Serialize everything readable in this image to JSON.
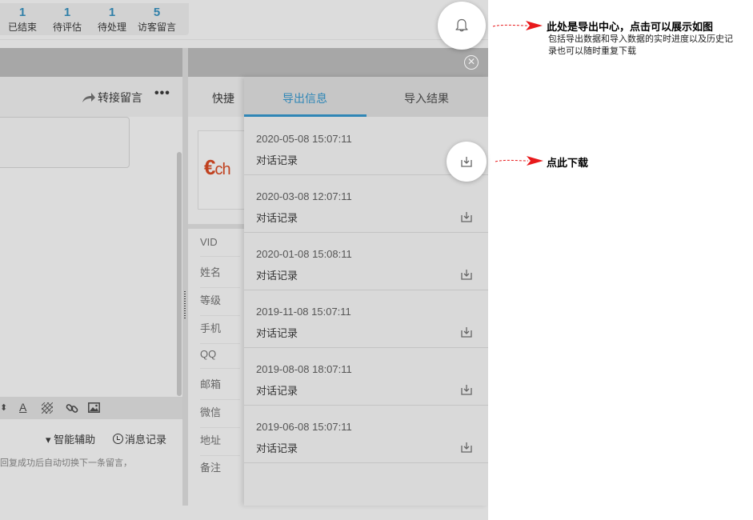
{
  "stats": [
    {
      "count": "1",
      "label": "已结束"
    },
    {
      "count": "1",
      "label": "待评估"
    },
    {
      "count": "1",
      "label": "待处理"
    },
    {
      "count": "5",
      "label": "访客留言"
    }
  ],
  "left_pane": {
    "transfer_label": "转接留言",
    "more_label": "•••",
    "assist_label": "▾ 智能辅助",
    "history_label": "消息记录",
    "hint_text": "回复成功后自动切换下一条留言，"
  },
  "middle_pane": {
    "tab_label": "快捷",
    "logo_text": "ch",
    "fields": [
      "VID",
      "姓名",
      "等级",
      "手机",
      "QQ",
      "邮箱",
      "微信",
      "地址",
      "备注"
    ]
  },
  "export_panel": {
    "tabs": [
      {
        "label": "导出信息",
        "active": true
      },
      {
        "label": "导入结果",
        "active": false
      }
    ],
    "records": [
      {
        "time": "2020-05-08 15:07:11",
        "type": "对话记录"
      },
      {
        "time": "2020-03-08 12:07:11",
        "type": "对话记录"
      },
      {
        "time": "2020-01-08 15:08:11",
        "type": "对话记录"
      },
      {
        "time": "2019-11-08 15:07:11",
        "type": "对话记录"
      },
      {
        "time": "2019-08-08 18:07:11",
        "type": "对话记录"
      },
      {
        "time": "2019-06-08 15:07:11",
        "type": "对话记录"
      }
    ]
  },
  "annotations": {
    "bell_title": "此处是导出中心，点击可以展示如图",
    "bell_desc": "包括导出数据和导入数据的实时进度以及历史记录也可以随时重复下载",
    "download_note": "点此下载"
  },
  "colors": {
    "accent": "#2f86b6",
    "arrow": "#e8191b",
    "overlay_bg": "#dcdcdc"
  },
  "icons": [
    "bell-icon",
    "download-icon",
    "close-icon",
    "share-arrow-icon",
    "clock-icon",
    "link-icon",
    "image-icon",
    "font-color-icon"
  ]
}
